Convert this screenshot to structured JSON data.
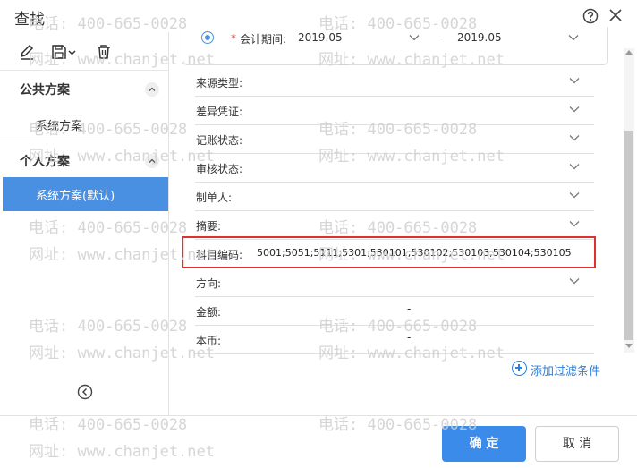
{
  "window": {
    "title": "查找",
    "help_icon": "question-circle-icon",
    "close_icon": "close-icon"
  },
  "sidebar": {
    "toolbar": [
      "edit-icon",
      "save-icon",
      "trash-icon"
    ],
    "groups": [
      {
        "label": "公共方案",
        "items": [
          {
            "label": "系统方案",
            "selected": false
          }
        ]
      },
      {
        "label": "个人方案",
        "items": [
          {
            "label": "系统方案(默认)",
            "selected": true
          }
        ]
      }
    ]
  },
  "period": {
    "required_mark": "*",
    "label": "会计期间:",
    "from": "2019.05",
    "to": "2019.05",
    "separator": "-"
  },
  "fields": [
    {
      "label": "来源类型:"
    },
    {
      "label": "差异凭证:"
    },
    {
      "label": "记账状态:"
    },
    {
      "label": "审核状态:"
    },
    {
      "label": "制单人:"
    },
    {
      "label": "摘要:"
    },
    {
      "label": "科目编码:",
      "value": "5001;5051;5111;5301;530101;530102;530103;530104;530105"
    },
    {
      "label": "方向:"
    },
    {
      "label": "金额:",
      "range_separator": "-"
    },
    {
      "label": "本币:",
      "range_separator": "-"
    }
  ],
  "add_filter": {
    "label": "添加过滤条件"
  },
  "footer": {
    "ok_label": "确 定",
    "cancel_label": "取 消"
  },
  "watermark": {
    "phone": "电话: 400-665-0028",
    "website": "网址: www.chanjet.net"
  },
  "colors": {
    "accent": "#3b8bea",
    "selected_bg": "#4a90e2",
    "highlight": "#e0302b",
    "link": "#2f80d8",
    "required": "#e43c3c"
  }
}
